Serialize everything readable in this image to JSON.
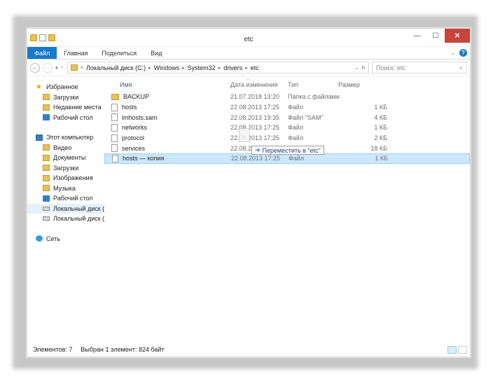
{
  "window": {
    "title": "etc"
  },
  "window_buttons": {
    "minimize": "—",
    "maximize": "☐",
    "close": "✕"
  },
  "ribbon": {
    "file_tab": "Файл",
    "tabs": [
      "Главная",
      "Поделиться",
      "Вид"
    ],
    "help": "?"
  },
  "navigation": {
    "back": "←",
    "forward": "→",
    "recent": "▾",
    "up": "↑",
    "breadcrumb": [
      "Локальный диск (C:)",
      "Windows",
      "System32",
      "drivers",
      "etc"
    ],
    "refresh": "↻",
    "search_placeholder": "Поиск: etc"
  },
  "sidebar": {
    "favorites_label": "Избранное",
    "favorites": [
      "Загрузки",
      "Недавние места",
      "Рабочий стол"
    ],
    "computer_label": "Этот компьютер",
    "computer_items": [
      "Видео",
      "Документы",
      "Загрузки",
      "Изображения",
      "Музыка",
      "Рабочий стол",
      "Локальный диск (C",
      "Локальный диск (D"
    ],
    "network_label": "Сеть"
  },
  "columns": {
    "name": "Имя",
    "date": "Дата изменения",
    "type": "Тип",
    "size": "Размер"
  },
  "files": [
    {
      "name": "BACKUP",
      "date": "21.07.2018 13:20",
      "type": "Папка с файлами",
      "size": "",
      "kind": "folder"
    },
    {
      "name": "hosts",
      "date": "22.08.2013 17:25",
      "type": "Файл",
      "size": "1 КБ",
      "kind": "file"
    },
    {
      "name": "lmhosts.sam",
      "date": "22.08.2013 19:35",
      "type": "Файл \"SAM\"",
      "size": "4 КБ",
      "kind": "file"
    },
    {
      "name": "networks",
      "date": "22.08.2013 17:25",
      "type": "Файл",
      "size": "1 КБ",
      "kind": "file"
    },
    {
      "name": "protocol",
      "date": "22.08.2013 17:25",
      "type": "Файл",
      "size": "2 КБ",
      "kind": "file"
    },
    {
      "name": "services",
      "date": "22.08.2013 17:25",
      "type": "Файл",
      "size": "18 КБ",
      "kind": "file"
    },
    {
      "name": "hosts — копия",
      "date": "22.08.2013 17:25",
      "type": "Файл",
      "size": "1 КБ",
      "kind": "file",
      "selected": true
    }
  ],
  "drag_tooltip": "Переместить в \"etc\"",
  "status": {
    "count": "Элементов: 7",
    "selection": "Выбран 1 элемент: 824 байт"
  },
  "colors": {
    "accent": "#1979ca",
    "close": "#c7453a",
    "selection": "#cce8ff"
  }
}
